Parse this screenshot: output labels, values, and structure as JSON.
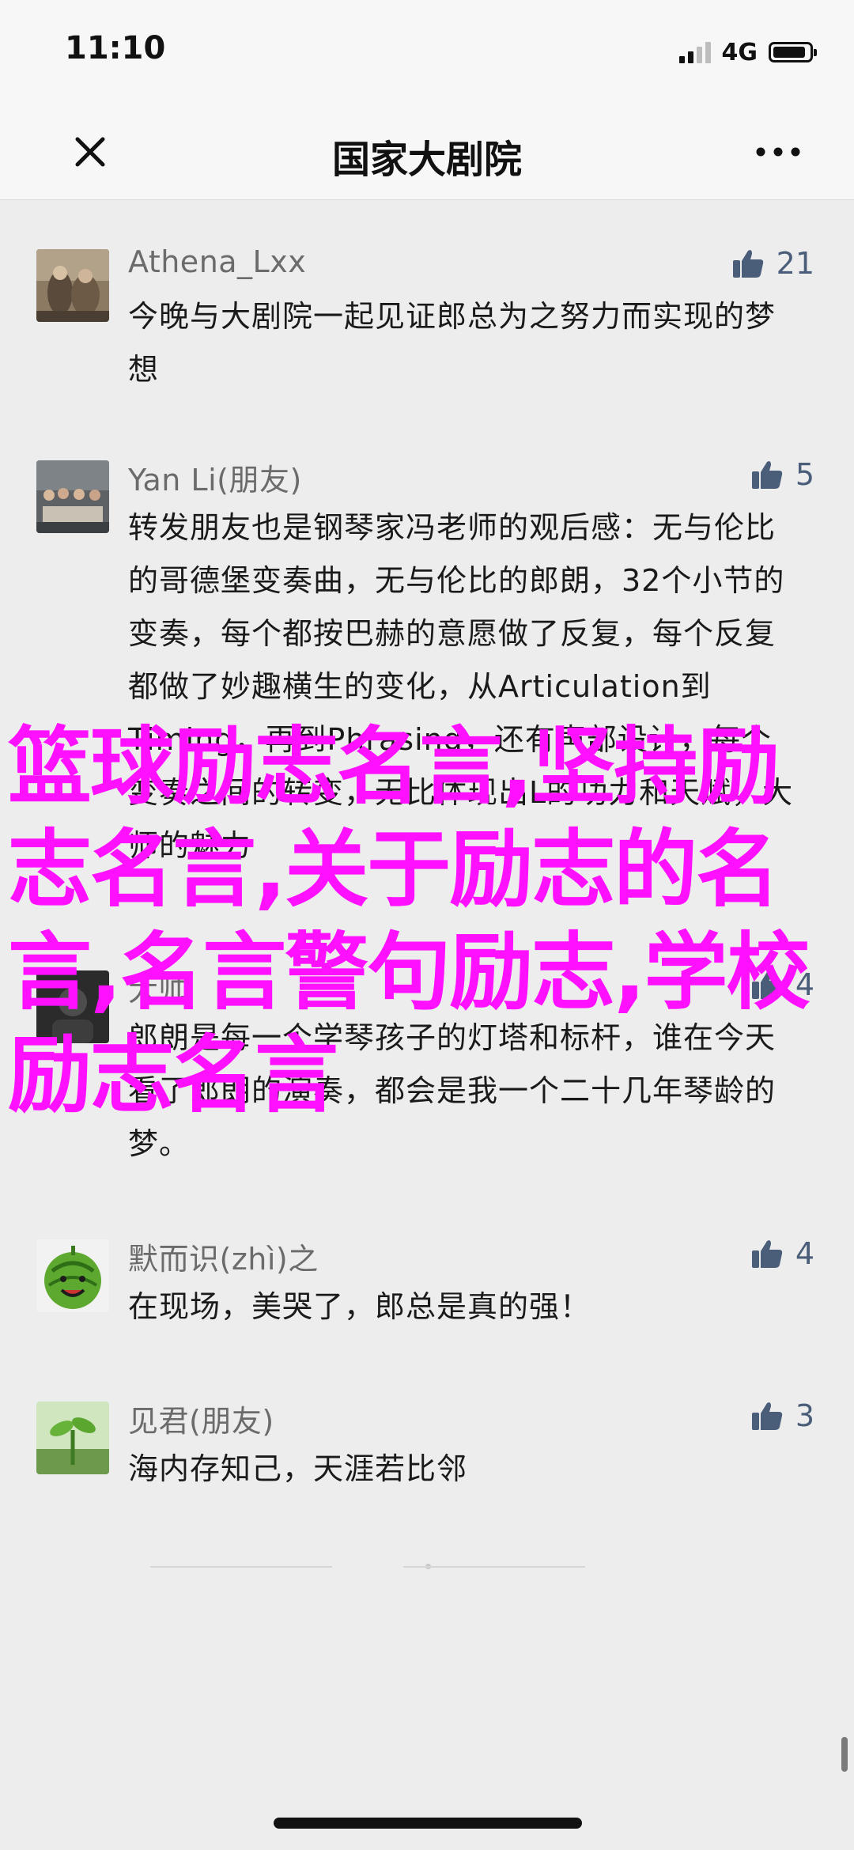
{
  "status_bar": {
    "time": "11:10",
    "network": "4G",
    "battery_level": 0.9
  },
  "nav": {
    "title": "国家大剧院",
    "close_icon": "close-icon",
    "more_icon": "more-icon"
  },
  "comments": [
    {
      "author": "Athena_Lxx",
      "likes": "21",
      "text": "今晚与大剧院一起见证郎总为之努力而实现的梦想",
      "avatar": "painting-avatar"
    },
    {
      "author": "Yan Li(朋友)",
      "likes": "5",
      "text": "转发朋友也是钢琴家冯老师的观后感：无与伦比的哥德堡变奏曲，无与伦比的郎朗，32个小节的变奏，每个都按巴赫的意愿做了反复，每个反复都做了妙趣横生的变化，从Articulation到Timing，再到Phrasing，还有声部设计，每个变奏之间的转变，无比体现出L的功力和天赋，大师的魅力",
      "avatar": "group-photo-avatar"
    },
    {
      "author": "大帅",
      "likes": "4",
      "text": "郎朗是每一个学琴孩子的灯塔和标杆，谁在今天看了郎朗的演奏，都会是我一个二十几年琴龄的梦。",
      "avatar": "dark-avatar"
    },
    {
      "author": "默而识(zhì)之",
      "likes": "4",
      "text": "在现场，美哭了，郎总是真的强！",
      "avatar": "watermelon-avatar"
    },
    {
      "author": "见君(朋友)",
      "likes": "3",
      "text": "海内存知己，天涯若比邻",
      "avatar": "sprout-avatar"
    }
  ],
  "overlay_title": "篮球励志名言,坚持励志名言,关于励志的名言,名言警句励志,学校励志名言",
  "colors": {
    "background": "#ededed",
    "overlay": "#ff10ff",
    "like": "#4a5d79",
    "author": "#6b6b6b"
  }
}
